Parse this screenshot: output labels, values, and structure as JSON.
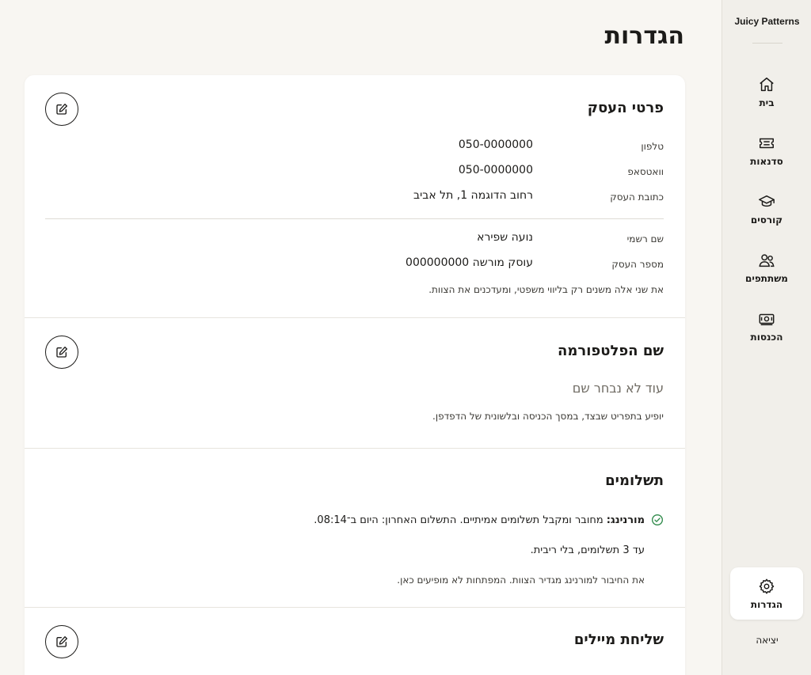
{
  "brand": "Juicy Patterns",
  "nav": {
    "items": [
      {
        "label": "בית",
        "icon": "home-icon"
      },
      {
        "label": "סדנאות",
        "icon": "ticket-icon"
      },
      {
        "label": "קורסים",
        "icon": "graduation-cap-icon"
      },
      {
        "label": "משתתפים",
        "icon": "users-icon"
      },
      {
        "label": "הכנסות",
        "icon": "cash-icon"
      },
      {
        "label": "הגדרות",
        "icon": "gear-icon"
      }
    ],
    "active": "הגדרות",
    "logout": "יציאה"
  },
  "page": {
    "title": "הגדרות"
  },
  "business": {
    "title": "פרטי העסק",
    "phone_label": "טלפון",
    "phone_value": "050-0000000",
    "whatsapp_label": "וואטסאפ",
    "whatsapp_value": "050-0000000",
    "address_label": "כתובת העסק",
    "address_value": "רחוב הדוגמה 1, תל אביב",
    "legal_name_label": "שם רשמי",
    "legal_name_value": "נועה שפירא",
    "business_number_label": "מספר העסק",
    "business_number_value": "עוסק מורשה 000000000",
    "note": "את שני אלה משנים רק בליווי משפטי, ומעדכנים את הצוות."
  },
  "platform": {
    "title": "שם הפלטפורמה",
    "value": "עוד לא נבחר שם",
    "note": "יופיע בתפריט שבצד, במסך הכניסה ובלשונית של הדפדפן."
  },
  "payments": {
    "title": "תשלומים",
    "provider": "מורנינג:",
    "status": "מחובר ומקבל תשלומים אמיתיים. התשלום האחרון: היום ב־08:14.",
    "installments": "עד 3 תשלומים, בלי ריבית.",
    "note": "את החיבור למורנינג מגדיר הצוות. המפתחות לא מופיעים כאן."
  },
  "emails": {
    "title": "שליחת מיילים"
  }
}
